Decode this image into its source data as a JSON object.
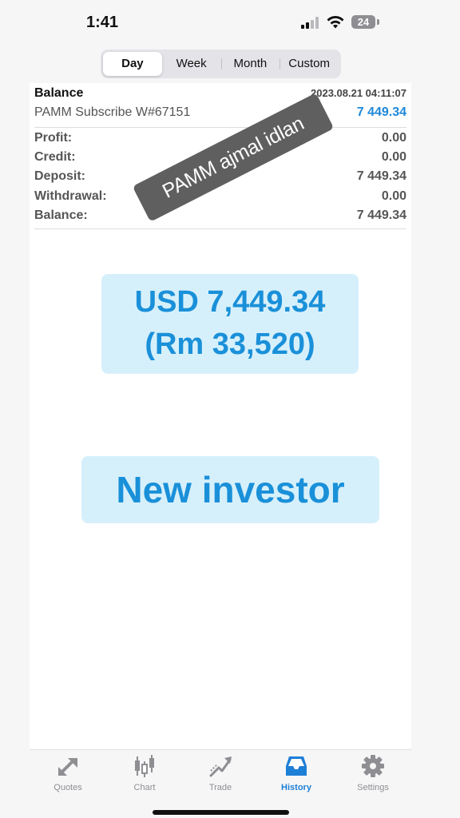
{
  "status_bar": {
    "time": "1:41",
    "battery": "24"
  },
  "period_tabs": [
    {
      "label": "Day",
      "active": true
    },
    {
      "label": "Week",
      "active": false
    },
    {
      "label": "Month",
      "active": false
    },
    {
      "label": "Custom",
      "active": false
    }
  ],
  "balance_entry": {
    "title": "Balance",
    "datetime": "2023.08.21 04:11:07",
    "description": "PAMM Subscribe W#67151",
    "amount": "7 449.34",
    "amount_color": "#1e88d8"
  },
  "summary": {
    "profit_label": "Profit:",
    "profit_value": "0.00",
    "credit_label": "Credit:",
    "credit_value": "0.00",
    "deposit_label": "Deposit:",
    "deposit_value": "7 449.34",
    "withdrawal_label": "Withdrawal:",
    "withdrawal_value": "0.00",
    "balance_label": "Balance:",
    "balance_value": "7 449.34"
  },
  "overlay_label": "PAMM ajmal idlan",
  "highlight": {
    "usd_line": "USD 7,449.34",
    "rm_line": "(Rm 33,520)",
    "investor_line": "New investor",
    "text_color": "#1a90d9",
    "box_color": "#d6f0fb"
  },
  "tab_bar": [
    {
      "label": "Quotes",
      "icon": "quotes-arrows-icon",
      "active": false
    },
    {
      "label": "Chart",
      "icon": "candlestick-chart-icon",
      "active": false
    },
    {
      "label": "Trade",
      "icon": "trade-trend-icon",
      "active": false
    },
    {
      "label": "History",
      "icon": "history-inbox-icon",
      "active": true
    },
    {
      "label": "Settings",
      "icon": "gear-icon",
      "active": false
    }
  ]
}
